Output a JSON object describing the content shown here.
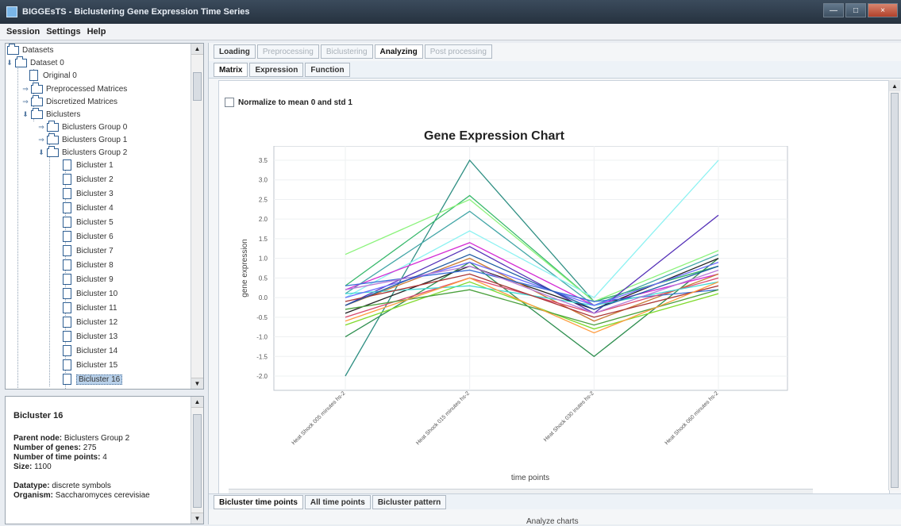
{
  "window": {
    "title": "BIGGEsTS - Biclustering Gene Expression Time Series"
  },
  "menu": {
    "items": [
      "Session",
      "Settings",
      "Help"
    ]
  },
  "tree": {
    "root": "Datasets",
    "dataset": "Dataset 0",
    "original": "Original 0",
    "preprocessed": "Preprocessed Matrices",
    "discretized": "Discretized Matrices",
    "biclusters": "Biclusters",
    "groups": [
      "Biclusters Group 0",
      "Biclusters Group 1",
      "Biclusters Group 2"
    ],
    "bicluster_items": [
      "Bicluster 1",
      "Bicluster 2",
      "Bicluster 3",
      "Bicluster 4",
      "Bicluster 5",
      "Bicluster 6",
      "Bicluster 7",
      "Bicluster 8",
      "Bicluster 9",
      "Bicluster 10",
      "Bicluster 11",
      "Bicluster 12",
      "Bicluster 13",
      "Bicluster 14",
      "Bicluster 15",
      "Bicluster 16"
    ]
  },
  "info": {
    "title": "Bicluster 16",
    "parent_label": "Parent node:",
    "parent_value": "Biclusters Group 2",
    "genes_label": "Number of genes:",
    "genes_value": "275",
    "timepoints_label": "Number of time points:",
    "timepoints_value": "4",
    "size_label": "Size:",
    "size_value": "1100",
    "datatype_label": "Datatype:",
    "datatype_value": "discrete symbols",
    "organism_label": "Organism:",
    "organism_value": "Saccharomyces cerevisiae"
  },
  "main_tabs": [
    "Loading",
    "Preprocessing",
    "Biclustering",
    "Analyzing",
    "Post processing"
  ],
  "sub_tabs": [
    "Matrix",
    "Expression",
    "Function"
  ],
  "normalize_label": "Normalize to mean 0 and std 1",
  "chart_title": "Gene Expression Chart",
  "bottom_tabs": [
    "Bicluster time points",
    "All time points",
    "Bicluster pattern"
  ],
  "status": "Analyze charts",
  "chart_data": {
    "type": "line",
    "title": "Gene Expression Chart",
    "xlabel": "time points",
    "ylabel": "gene expression",
    "categories": [
      "Heat Shock 005 minutes hs-2",
      "Heat Shock 015 minutes hs-2",
      "Heat Shock 030 inutes  hs-2",
      "Heat Shock 060 minutes hs-2"
    ],
    "ylim": [
      -2.0,
      3.5
    ],
    "yticks": [
      "3.5",
      "3.0",
      "2.5",
      "2.0",
      "1.5",
      "1.0",
      "0.5",
      "0.0",
      "-0.5",
      "-1.0",
      "-1.5",
      "-2.0"
    ],
    "grid": true,
    "series": [
      {
        "values": [
          -2.0,
          3.5,
          -0.1,
          0.8
        ],
        "color": "#2f8f83"
      },
      {
        "values": [
          0.3,
          2.6,
          -0.1,
          0.8
        ],
        "color": "#37b86b"
      },
      {
        "values": [
          0.1,
          2.2,
          -0.2,
          1.1
        ],
        "color": "#43a6a7"
      },
      {
        "values": [
          1.1,
          2.5,
          -0.1,
          1.2
        ],
        "color": "#8bf37b"
      },
      {
        "values": [
          0.0,
          1.7,
          0.0,
          3.5
        ],
        "color": "#8ef2f2"
      },
      {
        "values": [
          -0.2,
          1.3,
          -0.4,
          2.1
        ],
        "color": "#5531b8"
      },
      {
        "values": [
          -1.0,
          0.9,
          -1.5,
          1.0
        ],
        "color": "#2f8f50"
      },
      {
        "values": [
          0.2,
          1.4,
          -0.2,
          0.6
        ],
        "color": "#d42bd4"
      },
      {
        "values": [
          -0.4,
          0.8,
          -0.3,
          1.0
        ],
        "color": "#222222"
      },
      {
        "values": [
          -0.2,
          1.0,
          -0.6,
          0.6
        ],
        "color": "#c97a32"
      },
      {
        "values": [
          0.3,
          0.7,
          -0.1,
          0.2
        ],
        "color": "#3b72d8"
      },
      {
        "values": [
          -0.7,
          0.4,
          -0.8,
          0.1
        ],
        "color": "#7fda2b"
      },
      {
        "values": [
          -0.5,
          0.5,
          -0.4,
          0.5
        ],
        "color": "#d9486d"
      },
      {
        "values": [
          0.1,
          0.3,
          -0.2,
          0.4
        ],
        "color": "#3fd8d2"
      },
      {
        "values": [
          -0.1,
          0.6,
          -0.5,
          0.3
        ],
        "color": "#a93333"
      },
      {
        "values": [
          0.0,
          0.9,
          -0.2,
          0.9
        ],
        "color": "#6c6cff"
      },
      {
        "values": [
          -0.3,
          0.2,
          -0.7,
          0.2
        ],
        "color": "#4aa03d"
      },
      {
        "values": [
          0.2,
          0.8,
          -0.4,
          0.7
        ],
        "color": "#b77bd8"
      },
      {
        "values": [
          -0.6,
          0.5,
          -0.9,
          0.4
        ],
        "color": "#ff9c3f"
      },
      {
        "values": [
          -0.2,
          1.1,
          -0.3,
          0.8
        ],
        "color": "#1f5aa3"
      }
    ]
  }
}
